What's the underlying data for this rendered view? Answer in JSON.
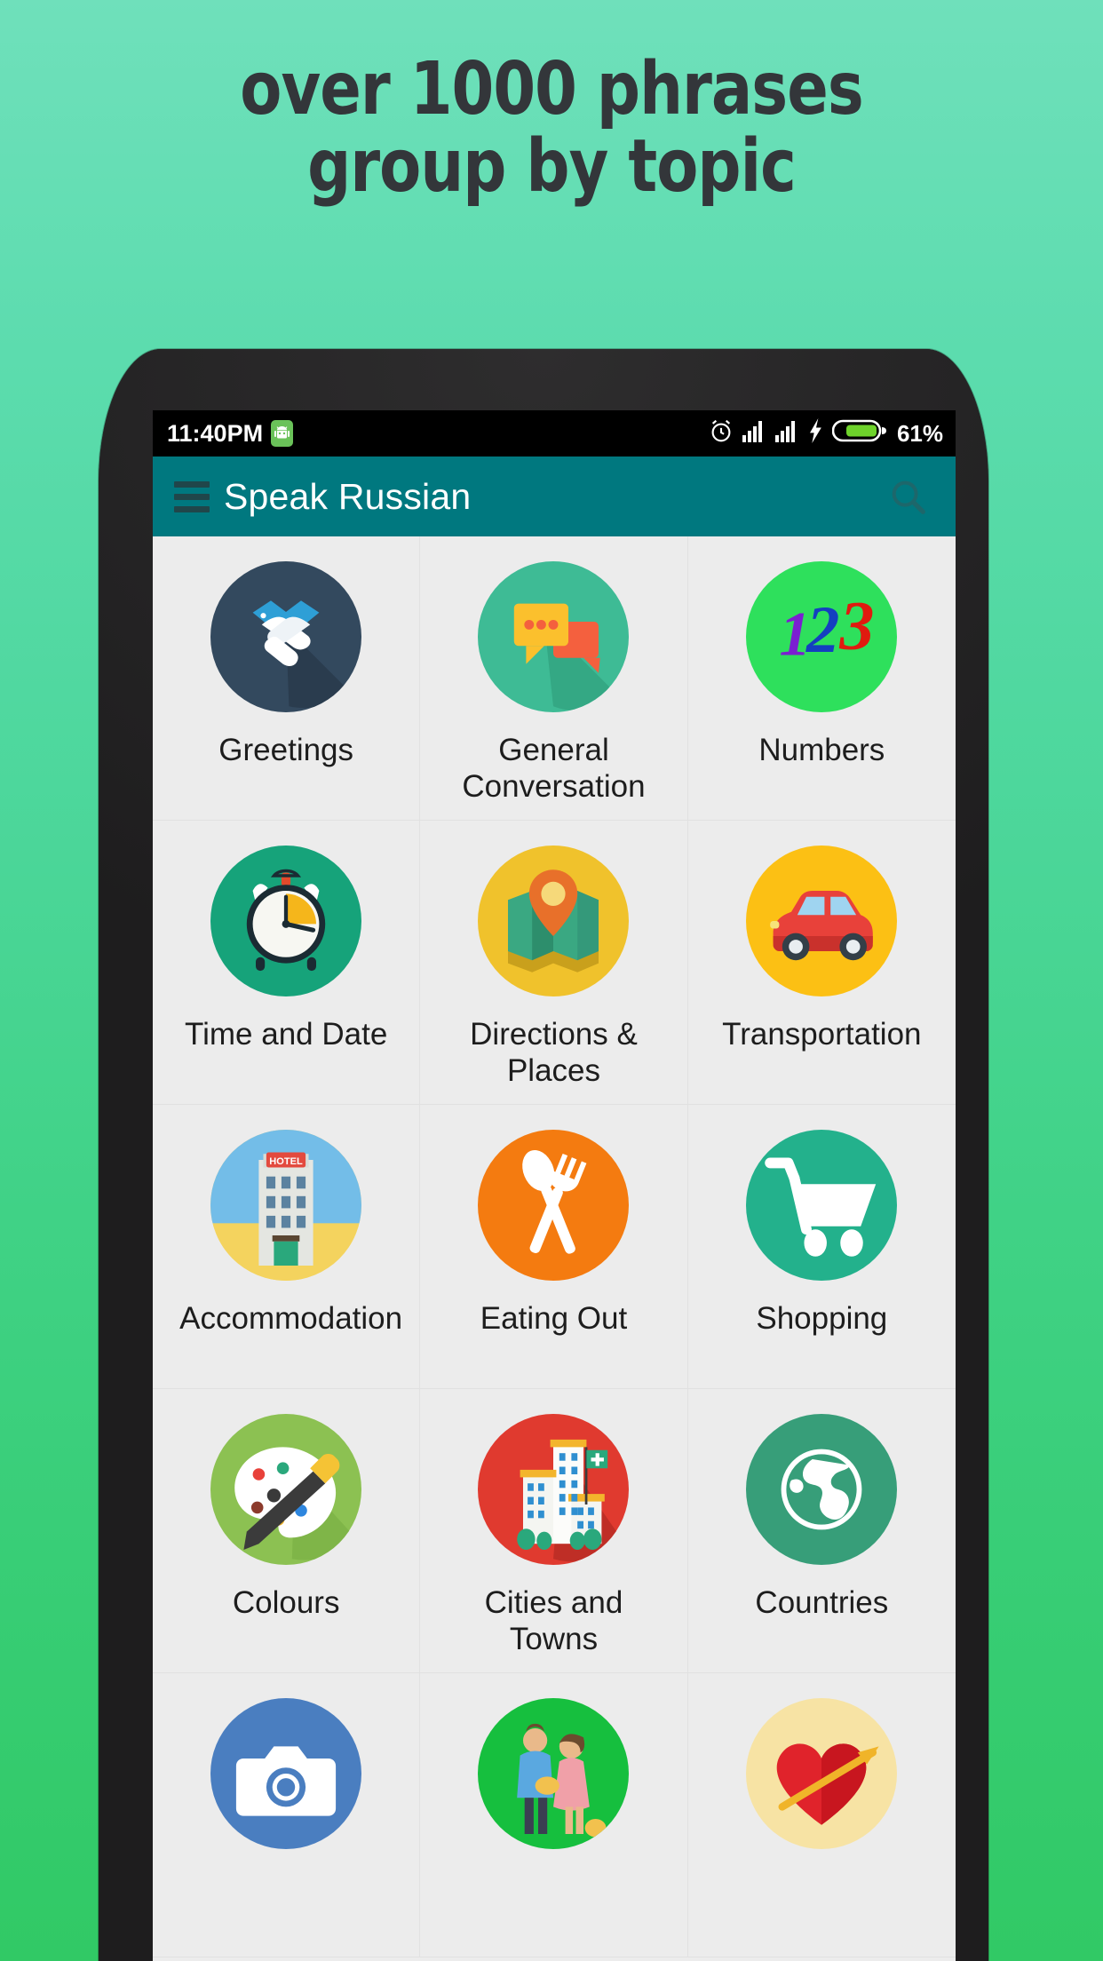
{
  "promo": {
    "line1": "over 1000 phrases",
    "line2": "group by topic",
    "text_color": "#33363a",
    "bg_top": "#6fe0bb",
    "bg_bottom": "#31c965"
  },
  "status_bar": {
    "time": "11:40PM",
    "battery_percent": "61%",
    "icons": [
      "android-icon",
      "alarm-icon",
      "signal-icon",
      "signal-icon",
      "charging-bolt-icon",
      "battery-icon"
    ]
  },
  "app_bar": {
    "title": "Speak Russian",
    "menu_icon": "hamburger-menu-icon",
    "search_icon": "search-icon",
    "color": "#00787f"
  },
  "grid": {
    "items": [
      {
        "label": "Greetings",
        "icon": "handshake-icon",
        "color": "#33495e"
      },
      {
        "label": "General Conversation",
        "icon": "speech-bubbles-icon",
        "color": "#3ebb95"
      },
      {
        "label": "Numbers",
        "icon": "numbers-123-icon",
        "color": "#2ee05c"
      },
      {
        "label": "Time and Date",
        "icon": "alarm-clock-icon",
        "color": "#16a37a"
      },
      {
        "label": "Directions & Places",
        "icon": "map-pin-icon",
        "color": "#f0c22c"
      },
      {
        "label": "Transportation",
        "icon": "car-icon",
        "color": "#fcc014"
      },
      {
        "label": "Accommodation",
        "icon": "hotel-icon",
        "color": "#f4d35e"
      },
      {
        "label": "Eating Out",
        "icon": "fork-spoon-icon",
        "color": "#f47b10"
      },
      {
        "label": "Shopping",
        "icon": "shopping-cart-icon",
        "color": "#23b18c"
      },
      {
        "label": "Colours",
        "icon": "paint-palette-icon",
        "color": "#8cc152"
      },
      {
        "label": "Cities and Towns",
        "icon": "city-buildings-icon",
        "color": "#e03a2f"
      },
      {
        "label": "Countries",
        "icon": "globe-icon",
        "color": "#379e79"
      },
      {
        "label": "",
        "icon": "camera-icon",
        "color": "#4a7ec0"
      },
      {
        "label": "",
        "icon": "couple-icon",
        "color": "#16bf3e"
      },
      {
        "label": "",
        "icon": "heart-arrow-icon",
        "color": "#f7e3a4"
      }
    ]
  }
}
